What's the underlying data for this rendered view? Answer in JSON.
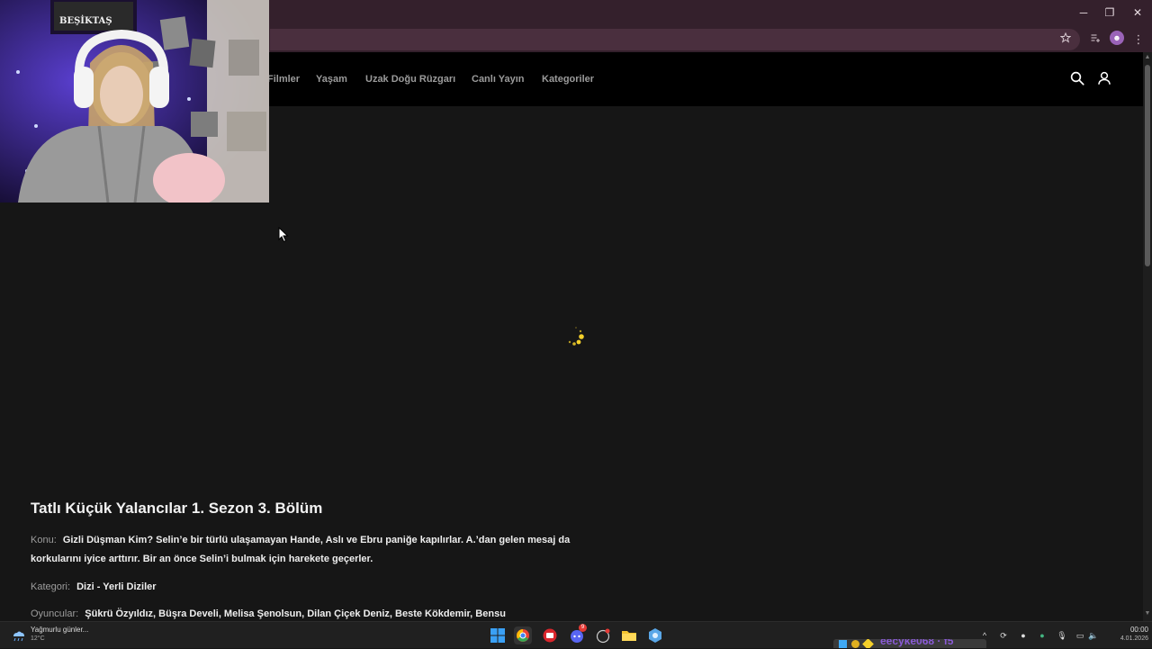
{
  "browser": {
    "window_controls": {
      "minimize": "─",
      "maximize": "❐",
      "close": "✕"
    },
    "toolbar": {
      "star_icon": "star-icon",
      "reading_list_icon": "reading-list-icon",
      "profile_initial": "☻",
      "menu_icon": "⋮"
    }
  },
  "site": {
    "nav": {
      "items": [
        {
          "label": "Filmler"
        },
        {
          "label": "Yaşam"
        },
        {
          "label": "Uzak Doğu Rüzgarı"
        },
        {
          "label": "Canlı Yayın"
        },
        {
          "label": "Kategoriler"
        }
      ],
      "search_icon": "search-icon",
      "user_icon": "user-icon"
    },
    "player": {
      "state": "loading",
      "spinner_color": "#f5d02a"
    },
    "episode": {
      "title": "Tatlı Küçük Yalancılar 1. Sezon 3. Bölüm",
      "synopsis_label": "Konu:",
      "synopsis": "Gizli Düşman Kim? Selin’e bir türlü ulaşamayan Hande, Aslı ve Ebru paniğe kapılırlar. A.’dan gelen mesaj da korkularını iyice arttırır. Bir an önce Selin’i bulmak için harekete geçerler.",
      "category_label": "Kategori:",
      "category": "Dizi - Yerli Diziler",
      "cast_label": "Oyuncular:",
      "cast": "Şükrü Özyıldız, Büşra Develi, Melisa Şenolsun, Dilan Çiçek Deniz, Beste Kökdemir, Bensu"
    }
  },
  "webcam": {
    "banner_text": "BEŞİKTAŞ"
  },
  "taskbar": {
    "weather": {
      "text": "Yağmurlu günler...",
      "temp": "12°C"
    },
    "apps": [
      "windows-start",
      "chrome",
      "app-red",
      "discord",
      "app-dark",
      "file-explorer",
      "app-settings"
    ],
    "discord_badge": "9",
    "clock": {
      "time": "00:00",
      "date": "4.01.2026"
    },
    "overlay_text": "eecyke068 · f5"
  },
  "colors": {
    "accent": "#f5d02a",
    "browser_frame": "#34202c",
    "page_bg": "#161616"
  }
}
